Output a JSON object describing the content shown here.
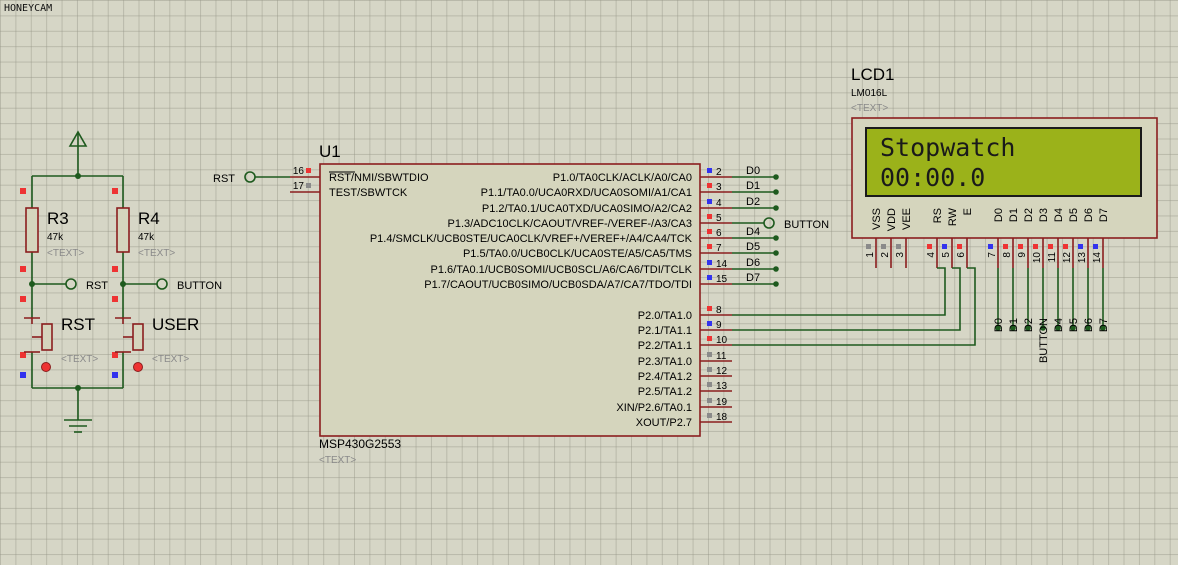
{
  "watermark": "HONEYCAM",
  "colors": {
    "background": "#d6d6c6",
    "wire": "#1e5a1e",
    "component_border": "#8b1e1e",
    "component_fill": "#d5d5bd",
    "lcd_screen": "#9bb21a",
    "pin_red": "#ee3333",
    "pin_blue": "#3333ee",
    "pin_gray": "#8a8a8a"
  },
  "mcu": {
    "ref": "U1",
    "part": "MSP430G2553",
    "text_placeholder": "<TEXT>",
    "left_pins": [
      {
        "num": "16",
        "name": "RST/NMI/SBWTDIO",
        "net": "RST"
      },
      {
        "num": "17",
        "name": "TEST/SBWTCK",
        "net": ""
      }
    ],
    "right_pins": [
      {
        "num": "2",
        "name": "P1.0/TA0CLK/ACLK/A0/CA0",
        "net": "D0"
      },
      {
        "num": "3",
        "name": "P1.1/TA0.0/UCA0RXD/UCA0SOMI/A1/CA1",
        "net": "D1"
      },
      {
        "num": "4",
        "name": "P1.2/TA0.1/UCA0TXD/UCA0SIMO/A2/CA2",
        "net": "D2"
      },
      {
        "num": "5",
        "name": "P1.3/ADC10CLK/CAOUT/VREF-/VEREF-/A3/CA3",
        "net": "BUTTON"
      },
      {
        "num": "6",
        "name": "P1.4/SMCLK/UCB0STE/UCA0CLK/VREF+/VEREF+/A4/CA4/TCK",
        "net": "D4"
      },
      {
        "num": "7",
        "name": "P1.5/TA0.0/UCB0CLK/UCA0STE/A5/CA5/TMS",
        "net": "D5"
      },
      {
        "num": "14",
        "name": "P1.6/TA0.1/UCB0SOMI/UCB0SCL/A6/CA6/TDI/TCLK",
        "net": "D6"
      },
      {
        "num": "15",
        "name": "P1.7/CAOUT/UCB0SIMO/UCB0SDA/A7/CA7/TDO/TDI",
        "net": "D7"
      },
      {
        "num": "8",
        "name": "P2.0/TA1.0",
        "net": ""
      },
      {
        "num": "9",
        "name": "P2.1/TA1.1",
        "net": ""
      },
      {
        "num": "10",
        "name": "P2.2/TA1.1",
        "net": ""
      },
      {
        "num": "11",
        "name": "P2.3/TA1.0",
        "net": ""
      },
      {
        "num": "12",
        "name": "P2.4/TA1.2",
        "net": ""
      },
      {
        "num": "13",
        "name": "P2.5/TA1.2",
        "net": ""
      },
      {
        "num": "19",
        "name": "XIN/P2.6/TA0.1",
        "net": ""
      },
      {
        "num": "18",
        "name": "XOUT/P2.7",
        "net": ""
      }
    ]
  },
  "lcd": {
    "ref": "LCD1",
    "part": "LM016L",
    "text_placeholder": "<TEXT>",
    "line1": "Stopwatch",
    "line2": "00:00.0",
    "pins": [
      {
        "num": "1",
        "name": "VSS",
        "net": ""
      },
      {
        "num": "2",
        "name": "VDD",
        "net": ""
      },
      {
        "num": "3",
        "name": "VEE",
        "net": ""
      },
      {
        "num": "4",
        "name": "RS",
        "net": ""
      },
      {
        "num": "5",
        "name": "RW",
        "net": ""
      },
      {
        "num": "6",
        "name": "E",
        "net": ""
      },
      {
        "num": "7",
        "name": "D0",
        "net": "D0"
      },
      {
        "num": "8",
        "name": "D1",
        "net": "D1"
      },
      {
        "num": "9",
        "name": "D2",
        "net": "D2"
      },
      {
        "num": "10",
        "name": "D3",
        "net": "BUTTON"
      },
      {
        "num": "11",
        "name": "D4",
        "net": "D4"
      },
      {
        "num": "12",
        "name": "D5",
        "net": "D5"
      },
      {
        "num": "13",
        "name": "D6",
        "net": "D6"
      },
      {
        "num": "14",
        "name": "D7",
        "net": "D7"
      }
    ]
  },
  "resistors": [
    {
      "ref": "R3",
      "value": "47k",
      "text_placeholder": "<TEXT>"
    },
    {
      "ref": "R4",
      "value": "47k",
      "text_placeholder": "<TEXT>"
    }
  ],
  "buttons": [
    {
      "ref": "RST",
      "text_placeholder": "<TEXT>"
    },
    {
      "ref": "USER",
      "text_placeholder": "<TEXT>"
    }
  ],
  "terminals": {
    "rst_left": "RST",
    "rst_net": "RST",
    "button_net": "BUTTON",
    "button_mcu": "BUTTON"
  }
}
